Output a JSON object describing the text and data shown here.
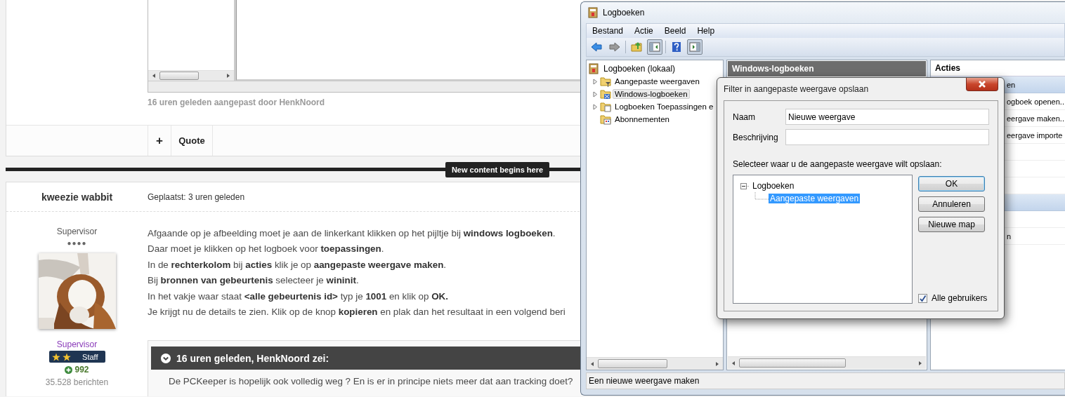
{
  "forum": {
    "previous_post": {
      "edited_note": "16 uren geleden aangepast door HenkNoord",
      "footer_actions": [
        {
          "kind": "plus",
          "label": "+"
        },
        {
          "kind": "quote",
          "label": "Quote"
        }
      ]
    },
    "new_content_label": "New content begins here",
    "post": {
      "author": "kweezie wabbit",
      "posted": "Geplaatst: 3 uren geleden",
      "user_title": "Supervisor",
      "rank_pips": "●●●●",
      "group": "Supervisor",
      "badge": {
        "label": "Staff"
      },
      "reputation": "992",
      "post_count": "35.528 berichten",
      "body": [
        "Afgaande op je afbeelding moet je aan de linkerkant klikken op het pijltje bij **windows logboeken**.",
        "Daar moet je klikken op het logboek voor **toepassingen**.",
        "In de **rechterkolom** bij **acties** klik je op **aangepaste weergave maken**.",
        "Bij **bronnen van gebeurtenis** selecteer je **wininit**.",
        "In het vakje waar staat **<alle gebeurtenis id>** typ je **1001** en klik op **OK.**",
        "Je krijgt nu de details te zien. Klik op de knop **kopieren** en plak dan het resultaat in een volgend beri"
      ],
      "quote": {
        "header": "16 uren geleden, HenkNoord zei:",
        "text": "De PCKeeper is hopelijk ook volledig weg ? En is er in principe niets meer dat aan tracking doet?"
      }
    }
  },
  "window": {
    "title": "Logboeken",
    "menu": [
      "Bestand",
      "Actie",
      "Beeld",
      "Help"
    ],
    "toolbar": [
      {
        "kind": "back",
        "on": false
      },
      {
        "kind": "forward",
        "on": false
      },
      {
        "kind": "separator"
      },
      {
        "kind": "up",
        "on": false
      },
      {
        "kind": "tree",
        "on": true
      },
      {
        "kind": "separator"
      },
      {
        "kind": "help",
        "on": false
      },
      {
        "kind": "actionpane",
        "on": true
      }
    ],
    "tree": {
      "label": "Logboeken (lokaal)",
      "children": [
        {
          "label": "Aangepaste weergaven",
          "kind": "filter",
          "expanded": false,
          "selected": false
        },
        {
          "label": "Windows-logboeken",
          "kind": "logs",
          "expanded": false,
          "selected": true
        },
        {
          "label": "Logboeken Toepassingen e",
          "kind": "folder",
          "expanded": false,
          "selected": false
        },
        {
          "label": "Abonnementen",
          "kind": "subscriptions",
          "selected": false
        }
      ]
    },
    "center_pane": {
      "header": "Windows-logboeken"
    },
    "actions_pane": {
      "header": "Acties",
      "items": [
        {
          "kind": "section",
          "text": "en"
        },
        {
          "kind": "action",
          "text": "ogboek openen..."
        },
        {
          "kind": "action",
          "text": "eergave maken..."
        },
        {
          "kind": "action",
          "text": "eergave importe"
        },
        {
          "kind": "action"
        },
        {
          "kind": "action"
        },
        {
          "kind": "action"
        },
        {
          "kind": "section"
        },
        {
          "kind": "action"
        },
        {
          "kind": "action",
          "text": "n"
        }
      ]
    },
    "status_bar": "Een nieuwe weergave maken"
  },
  "dialog": {
    "title": "Filter in aangepaste weergave opslaan",
    "fields": [
      {
        "label": "Naam",
        "value": "Nieuwe weergave"
      },
      {
        "label": "Beschrijving"
      }
    ],
    "prompt": "Selecteer waar u de aangepaste weergave wilt opslaan:",
    "tree": {
      "label": "Logboeken",
      "expanded": true,
      "children": [
        {
          "label": "Aangepaste weergaven",
          "selected": true
        }
      ]
    },
    "buttons": [
      {
        "label": "OK",
        "default": true
      },
      {
        "label": "Annuleren",
        "default": false
      },
      {
        "label": "Nieuwe map",
        "default": false
      }
    ],
    "all_users": {
      "label": "Alle gebruikers",
      "checked": true
    }
  }
}
